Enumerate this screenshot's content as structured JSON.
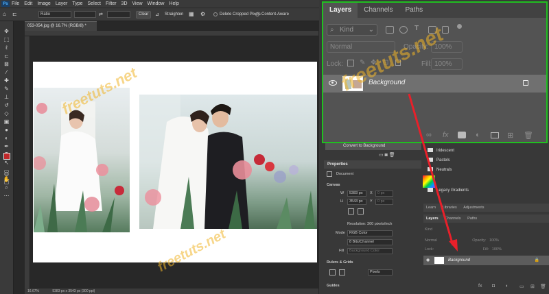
{
  "app": {
    "logo": "Ps",
    "menu": [
      "File",
      "Edit",
      "Image",
      "Layer",
      "Type",
      "Select",
      "Filter",
      "3D",
      "View",
      "Window",
      "Help"
    ]
  },
  "options_bar": {
    "ratio_value": "Ratio",
    "clear_label": "Clear",
    "straighten_label": "Straighten",
    "delete_cropped_label": "Delete Cropped Pixels",
    "content_aware_label": "Content-Aware"
  },
  "document": {
    "tab_title": "053-054.jpg @ 16.7% (RGB/8) *",
    "zoom": "16.67%",
    "size_info": "5383 px x 3543 px (300 ppi)"
  },
  "layers_panel": {
    "tabs": [
      "Layers",
      "Channels",
      "Paths"
    ],
    "active_tab": "Layers",
    "filter_kind": "Kind",
    "blend_mode": "Normal",
    "opacity_label": "Opacity:",
    "opacity_value": "100%",
    "lock_label": "Lock:",
    "fill_label": "Fill:",
    "fill_value": "100%",
    "layer_name": "Background",
    "bottom_icons": [
      "link-icon",
      "fx-icon",
      "mask-icon",
      "adjustment-icon",
      "folder-icon",
      "new-layer-icon",
      "trash-icon"
    ]
  },
  "history": {
    "item": "Convert to Background"
  },
  "properties": {
    "title": "Properties",
    "document_label": "Document",
    "canvas_label": "Canvas",
    "w_label": "W",
    "w_value": "5383 px",
    "h_label": "H",
    "h_value": "3543 px",
    "x_label": "X",
    "x_value": "0 px",
    "y_label": "Y",
    "y_value": "0 px",
    "resolution": "Resolution: 300 pixels/inch",
    "mode_label": "Mode",
    "mode_value": "RGB Color",
    "bits_value": "8 Bits/Channel",
    "fill_label": "Fill",
    "fill_value": "Background Color",
    "rulers_label": "Rulers & Grids",
    "units_value": "Pixels",
    "guides_label": "Guides"
  },
  "gradients": {
    "items": [
      "Iridescent",
      "Pastels",
      "Neutrals",
      "Legacy Gradients"
    ]
  },
  "small_panel": {
    "tabs_top": [
      "Learn",
      "Libraries",
      "Adjustments"
    ],
    "tabs": [
      "Layers",
      "Channels",
      "Paths"
    ],
    "blend_mode": "Normal",
    "opacity_label": "Opacity:",
    "opacity_value": "100%",
    "lock_label": "Lock:",
    "fill_label": "Fill:",
    "fill_value": "100%",
    "layer_name": "Background",
    "filter_kind": "Kind"
  },
  "watermark": "freetuts.net",
  "colors": {
    "highlight_border": "#20c020",
    "arrow": "#e8202a",
    "foreground_swatch": "#c0282a"
  }
}
